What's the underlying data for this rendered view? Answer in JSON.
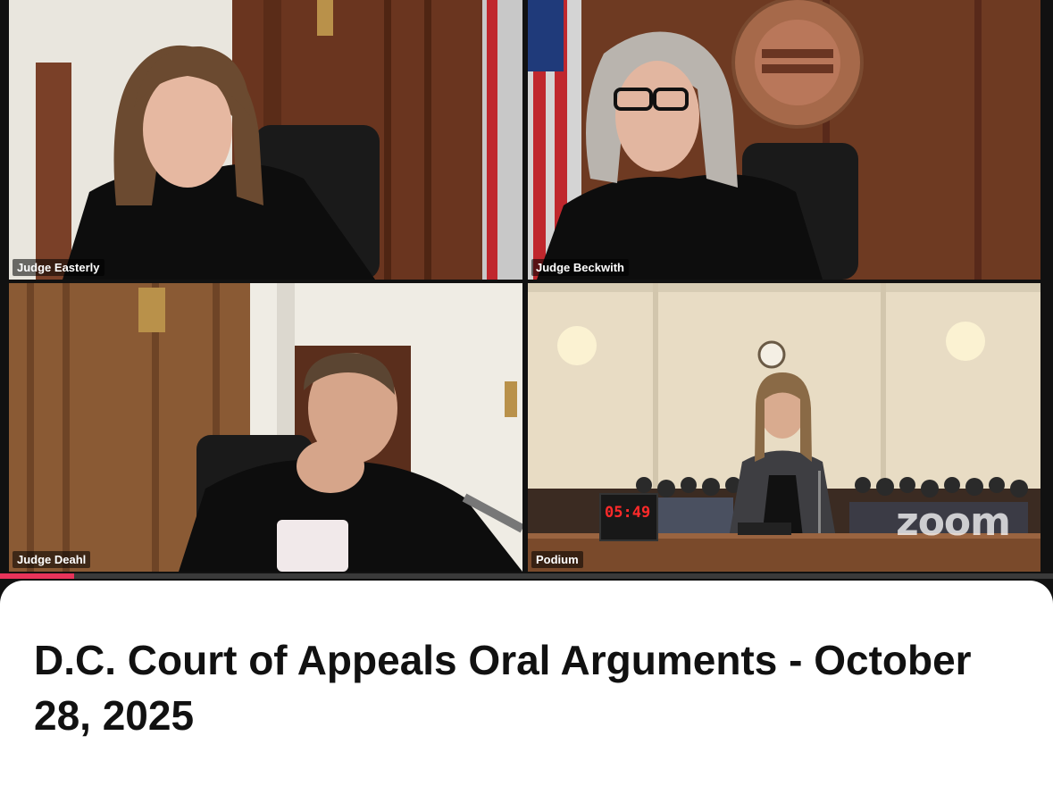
{
  "tiles": [
    {
      "name": "Judge Easterly"
    },
    {
      "name": "Judge Beckwith"
    },
    {
      "name": "Judge Deahl"
    },
    {
      "name": "Podium"
    }
  ],
  "podium": {
    "timer": "05:49",
    "watermark": "zoom"
  },
  "video": {
    "progress": 0.07
  },
  "post": {
    "title": "D.C. Court of Appeals Oral Arguments - October 28, 2025"
  },
  "colors": {
    "progress": "#e8335a",
    "name_tag_bg": "rgba(0,0,0,0.55)"
  }
}
